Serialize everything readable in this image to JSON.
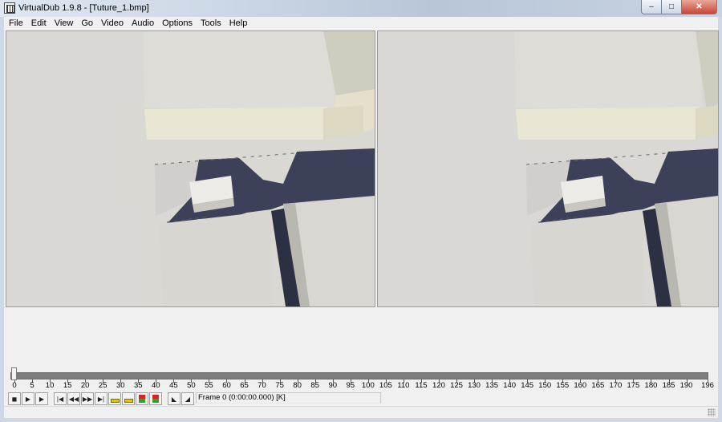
{
  "window": {
    "title": "VirtualDub 1.9.8 - [Tuture_1.bmp]",
    "controls": {
      "minimize": "–",
      "maximize": "□",
      "close": "✕"
    }
  },
  "menu": [
    "File",
    "Edit",
    "View",
    "Go",
    "Video",
    "Audio",
    "Options",
    "Tools",
    "Help"
  ],
  "panes": {
    "input": {
      "name": "input-video-pane",
      "icon": "frame-image"
    },
    "output": {
      "name": "output-video-pane",
      "icon": "frame-image"
    }
  },
  "timeline": {
    "current_frame": 0,
    "total_frames": 196,
    "tick_labels": [
      "0",
      "5",
      "10",
      "15",
      "20",
      "25",
      "30",
      "35",
      "40",
      "45",
      "50",
      "55",
      "60",
      "65",
      "70",
      "75",
      "80",
      "85",
      "90",
      "95",
      "100",
      "105",
      "110",
      "115",
      "120",
      "125",
      "130",
      "135",
      "140",
      "145",
      "150",
      "155",
      "160",
      "165",
      "170",
      "175",
      "180",
      "185",
      "190",
      "196"
    ]
  },
  "toolbar": {
    "buttons": [
      {
        "name": "stop-icon",
        "glyph": "◼"
      },
      {
        "name": "play-input-icon",
        "glyph": "▶"
      },
      {
        "name": "play-output-icon",
        "glyph": "▶"
      },
      {
        "name": "go-start-icon",
        "glyph": "|◀"
      },
      {
        "name": "prev-frame-icon",
        "glyph": "◀◀"
      },
      {
        "name": "next-frame-icon",
        "glyph": "▶▶"
      },
      {
        "name": "go-end-icon",
        "glyph": "▶|"
      },
      {
        "name": "prev-keyframe-icon",
        "glyph": ""
      },
      {
        "name": "next-keyframe-icon",
        "glyph": ""
      },
      {
        "name": "prev-scene-icon",
        "glyph": ""
      },
      {
        "name": "next-scene-icon",
        "glyph": ""
      },
      {
        "name": "mark-in-icon",
        "glyph": "◣"
      },
      {
        "name": "mark-out-icon",
        "glyph": "◢"
      }
    ],
    "frame_status": "Frame 0 (0:00:00.000) [K]"
  },
  "colors": {
    "titlebar": "#cdd8e6",
    "client_bg": "#f0f0f0",
    "trackbar": "#7d7d7d",
    "wall_light": "#e6e2d2",
    "shadow_blue": "#3b4057"
  }
}
